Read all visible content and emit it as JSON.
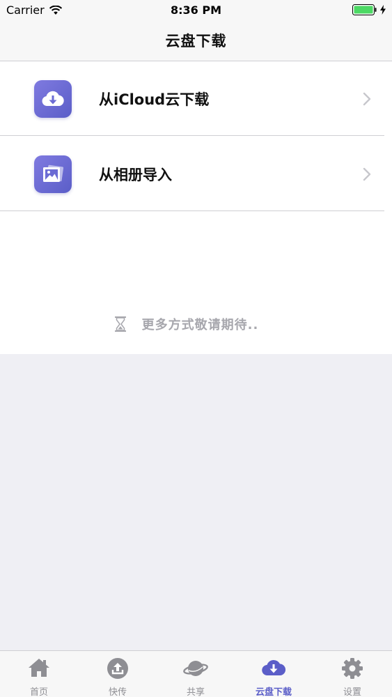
{
  "status_bar": {
    "carrier": "Carrier",
    "time": "8:36 PM",
    "battery_color": "#4cd964"
  },
  "nav": {
    "title": "云盘下载"
  },
  "list": {
    "items": [
      {
        "label": "从iCloud云下载",
        "icon": "cloud-download-icon"
      },
      {
        "label": "从相册导入",
        "icon": "photo-album-icon"
      }
    ]
  },
  "more": {
    "text": "更多方式敬请期待..",
    "icon": "hourglass-icon"
  },
  "tabs": [
    {
      "label": "首页",
      "icon": "home-icon",
      "active": false
    },
    {
      "label": "快传",
      "icon": "upload-circle-icon",
      "active": false
    },
    {
      "label": "共享",
      "icon": "planet-icon",
      "active": false
    },
    {
      "label": "云盘下载",
      "icon": "cloud-download-icon",
      "active": true
    },
    {
      "label": "设置",
      "icon": "gear-icon",
      "active": false
    }
  ],
  "colors": {
    "accent": "#5b5ec8",
    "inactive": "#8e8e93",
    "background": "#efeff4"
  }
}
